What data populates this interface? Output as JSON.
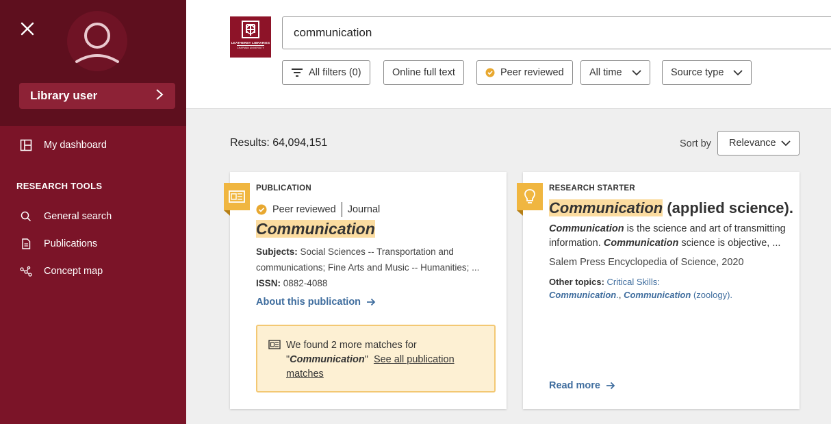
{
  "sidebar": {
    "user_label": "Library user",
    "dashboard_label": "My dashboard",
    "section_heading": "RESEARCH TOOLS",
    "items": [
      {
        "label": "General search",
        "icon": "search-icon"
      },
      {
        "label": "Publications",
        "icon": "document-icon"
      },
      {
        "label": "Concept map",
        "icon": "concept-map-icon"
      }
    ]
  },
  "header": {
    "logo_name": "LEATHERBY LIBRARIES",
    "logo_sub": "CHAPMAN UNIVERSITY",
    "search_value": "communication",
    "filters": {
      "all_filters": "All filters (0)",
      "online_full_text": "Online full text",
      "peer_reviewed": "Peer reviewed",
      "all_time": "All time",
      "source_type": "Source type"
    }
  },
  "results": {
    "count_label": "Results: 64,094,151",
    "sort_label": "Sort by",
    "sort_value": "Relevance"
  },
  "card1": {
    "type": "PUBLICATION",
    "peer_reviewed": "Peer reviewed",
    "format": "Journal",
    "title": "Communication",
    "subjects_label": "Subjects:",
    "subjects_value": "Social Sciences -- Transportation and communications; Fine Arts and Music -- Humanities; ...",
    "issn_label": "ISSN:",
    "issn_value": "0882-4088",
    "about_link": "About this publication",
    "notice_prefix": "We found 2 more matches for",
    "notice_quote_open": "\"",
    "notice_term": "Communication",
    "notice_quote_close": "\"",
    "notice_link": "See all publication matches"
  },
  "card2": {
    "type": "RESEARCH STARTER",
    "title_term": "Communication",
    "title_rest": " (applied science).",
    "abstract_term1": "Communication",
    "abstract_mid": " is the science and art of transmitting information. ",
    "abstract_term2": "Communication",
    "abstract_end": " science is objective, ...",
    "source": "Salem Press Encyclopedia of Science, 2020",
    "topics_label": "Other topics:",
    "topic1_prefix": "Critical Skills:",
    "topic1_term": "Communication",
    "topic1_suffix": ".",
    "topic_sep": ", ",
    "topic2_term": "Communication",
    "topic2_suffix": " (zoology).",
    "read_more": "Read more"
  },
  "colors": {
    "sidebar": "#7b1428",
    "sidebar_top": "#5e0f1e",
    "accent_link": "#3f6d9e",
    "highlight": "#fbdca0",
    "badge": "#f0b640"
  }
}
